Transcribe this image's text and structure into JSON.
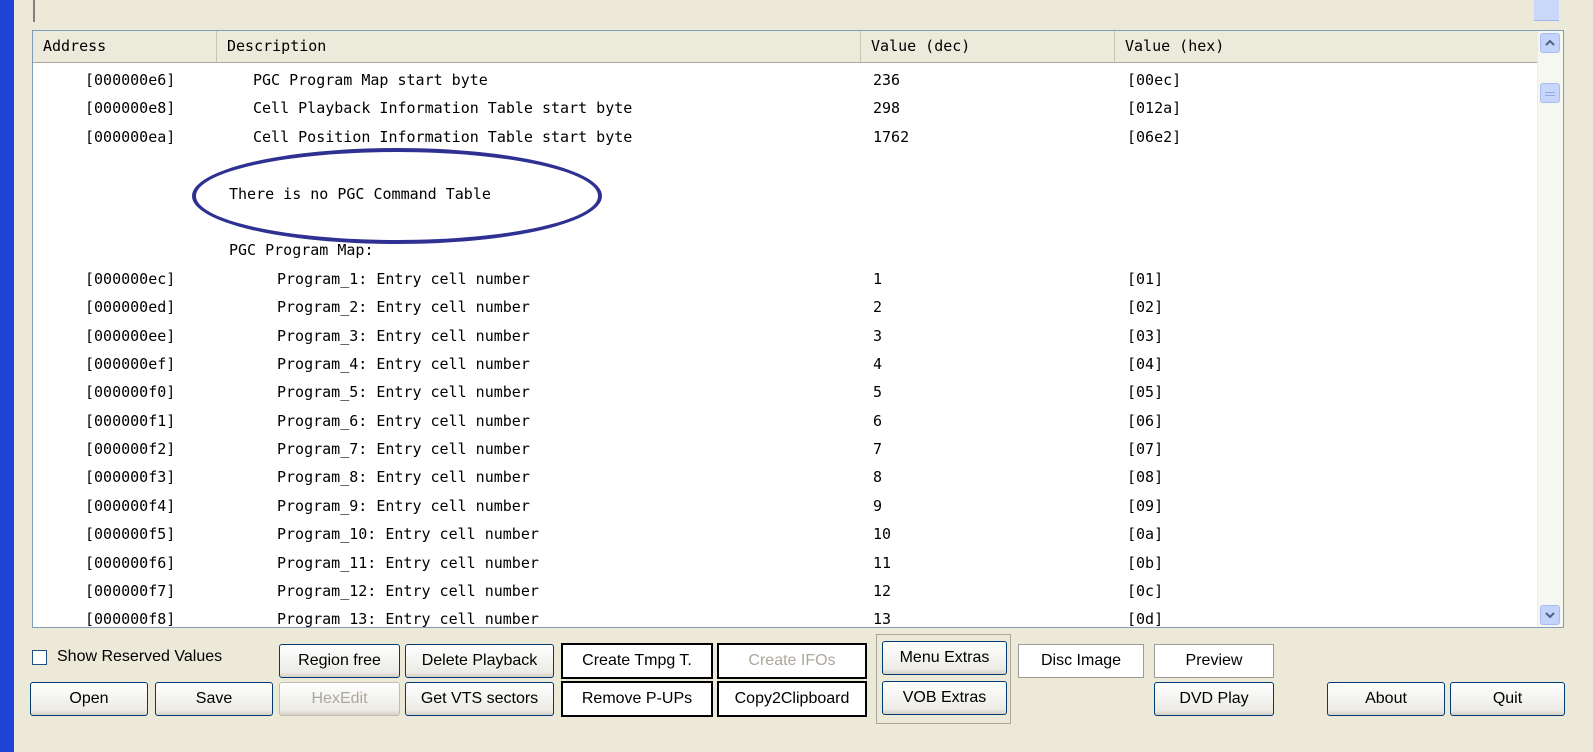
{
  "columns": [
    "Address",
    "Description",
    "Value (dec)",
    "Value (hex)"
  ],
  "rows": [
    {
      "addr": "[000000e6]",
      "desc": "PGC Program Map start byte",
      "dec": "236",
      "hex": "[00ec]",
      "indent": 1
    },
    {
      "addr": "[000000e8]",
      "desc": "Cell Playback Information Table start byte",
      "dec": "298",
      "hex": "[012a]",
      "indent": 1
    },
    {
      "addr": "[000000ea]",
      "desc": "Cell Position Information Table start byte",
      "dec": "1762",
      "hex": "[06e2]",
      "indent": 1
    },
    {
      "addr": "",
      "desc": "",
      "dec": "",
      "hex": "",
      "indent": 0
    },
    {
      "addr": "",
      "desc": "There is no PGC Command Table",
      "dec": "",
      "hex": "",
      "indent": 0
    },
    {
      "addr": "",
      "desc": "",
      "dec": "",
      "hex": "",
      "indent": 0
    },
    {
      "addr": "",
      "desc": "PGC Program Map:",
      "dec": "",
      "hex": "",
      "indent": 0
    },
    {
      "addr": "[000000ec]",
      "desc": "Program_1: Entry cell number",
      "dec": "1",
      "hex": "[01]",
      "indent": 2
    },
    {
      "addr": "[000000ed]",
      "desc": "Program_2: Entry cell number",
      "dec": "2",
      "hex": "[02]",
      "indent": 2
    },
    {
      "addr": "[000000ee]",
      "desc": "Program_3: Entry cell number",
      "dec": "3",
      "hex": "[03]",
      "indent": 2
    },
    {
      "addr": "[000000ef]",
      "desc": "Program_4: Entry cell number",
      "dec": "4",
      "hex": "[04]",
      "indent": 2
    },
    {
      "addr": "[000000f0]",
      "desc": "Program_5: Entry cell number",
      "dec": "5",
      "hex": "[05]",
      "indent": 2
    },
    {
      "addr": "[000000f1]",
      "desc": "Program_6: Entry cell number",
      "dec": "6",
      "hex": "[06]",
      "indent": 2
    },
    {
      "addr": "[000000f2]",
      "desc": "Program_7: Entry cell number",
      "dec": "7",
      "hex": "[07]",
      "indent": 2
    },
    {
      "addr": "[000000f3]",
      "desc": "Program_8: Entry cell number",
      "dec": "8",
      "hex": "[08]",
      "indent": 2
    },
    {
      "addr": "[000000f4]",
      "desc": "Program_9: Entry cell number",
      "dec": "9",
      "hex": "[09]",
      "indent": 2
    },
    {
      "addr": "[000000f5]",
      "desc": "Program_10: Entry cell number",
      "dec": "10",
      "hex": "[0a]",
      "indent": 2
    },
    {
      "addr": "[000000f6]",
      "desc": "Program_11: Entry cell number",
      "dec": "11",
      "hex": "[0b]",
      "indent": 2
    },
    {
      "addr": "[000000f7]",
      "desc": "Program_12: Entry cell number",
      "dec": "12",
      "hex": "[0c]",
      "indent": 2
    },
    {
      "addr": "[000000f8]",
      "desc": "Program_13: Entry cell number",
      "dec": "13",
      "hex": "[0d]",
      "indent": 2
    }
  ],
  "scrollbar": {
    "up_icon": "arrow-up-icon",
    "down_icon": "arrow-down-icon",
    "position": 0.05
  },
  "options": {
    "show_reserved_label": "Show Reserved Values",
    "show_reserved_checked": false
  },
  "buttons": {
    "region_free": "Region free",
    "delete_playback": "Delete Playback",
    "create_tmpg": "Create Tmpg T.",
    "create_ifos": "Create IFOs",
    "menu_extras": "Menu Extras",
    "disc_image": "Disc Image",
    "preview": "Preview",
    "open": "Open",
    "save": "Save",
    "hexedit": "HexEdit",
    "get_vts_sectors": "Get VTS sectors",
    "remove_pups": "Remove P-UPs",
    "copy2clipboard": "Copy2Clipboard",
    "vob_extras": "VOB Extras",
    "dvd_play": "DVD Play",
    "about": "About",
    "quit": "Quit"
  },
  "colors": {
    "window_border": "#1e43d6",
    "annotation": "#2e3192",
    "face": "#ece9d8"
  }
}
